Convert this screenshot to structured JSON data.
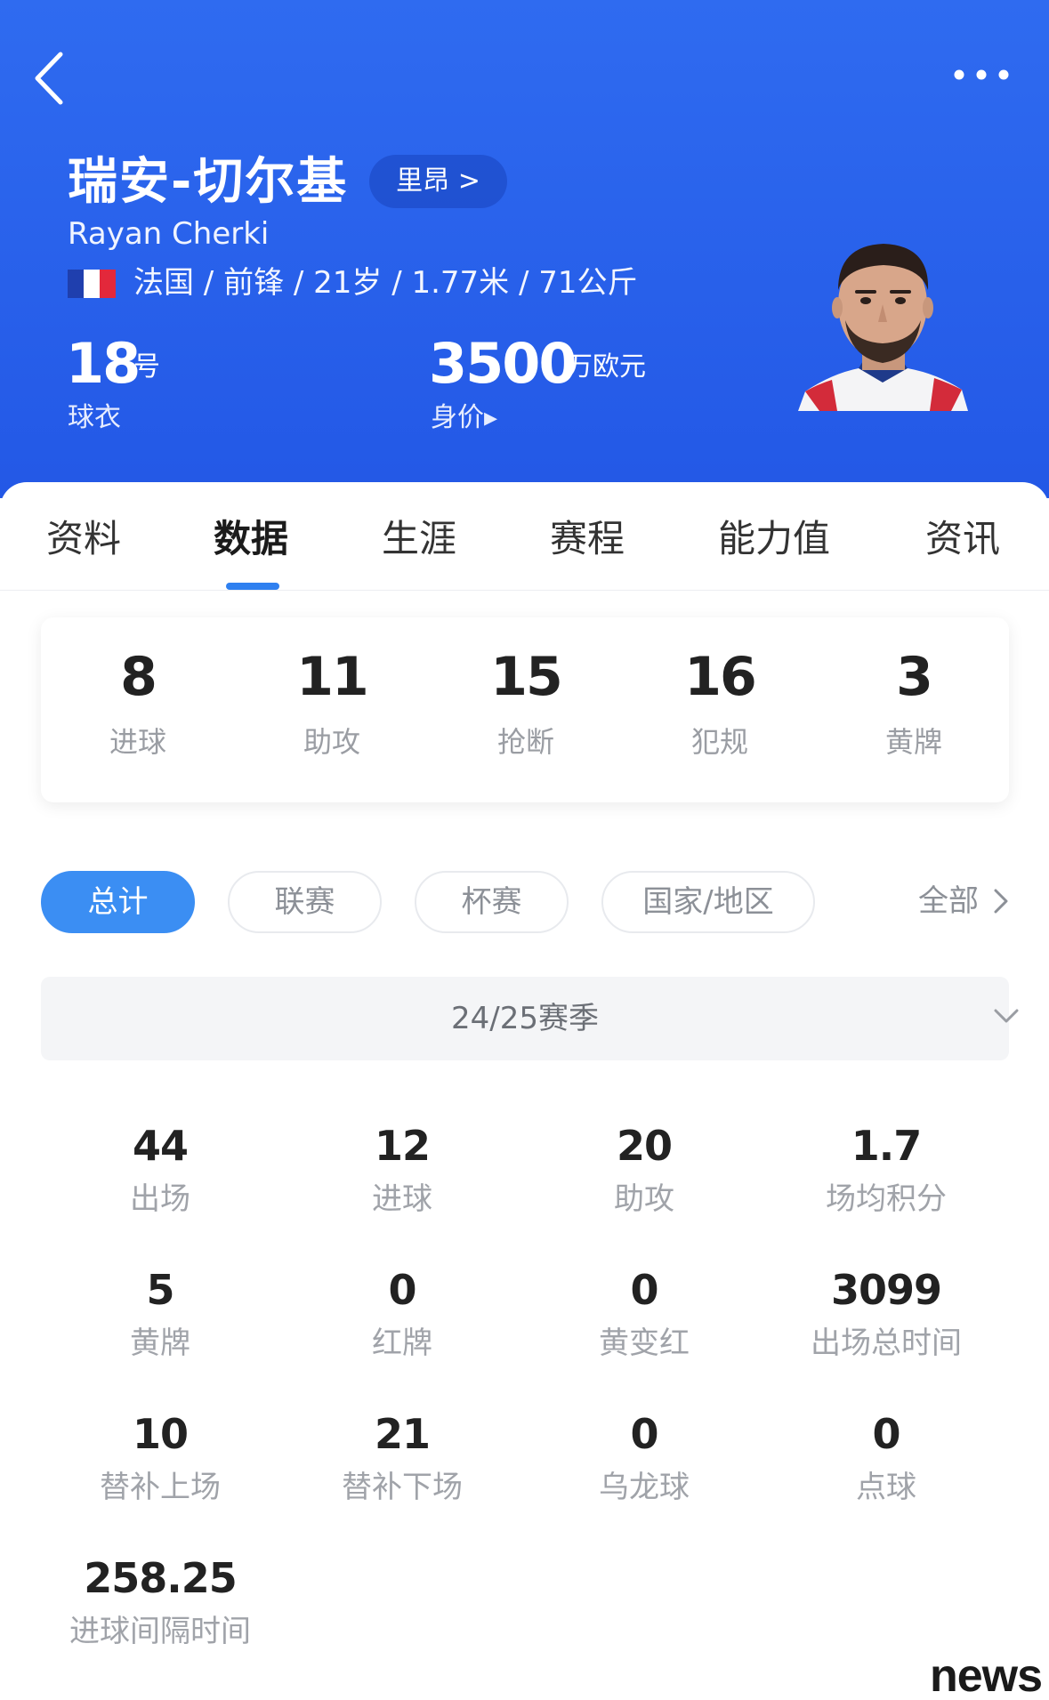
{
  "header": {
    "name_cn": "瑞安-切尔基",
    "team_link": "里昂 >",
    "name_en": "Rayan Cherki",
    "bio": "法国 / 前锋 / 21岁 / 1.77米 / 71公斤",
    "jersey_number": "18",
    "jersey_unit": "号",
    "jersey_label": "球衣",
    "market_value": "3500",
    "market_value_unit": "万欧元",
    "market_value_label": "身价▸",
    "flag_colors": [
      "#1f3fae",
      "#ffffff",
      "#e3283b"
    ],
    "background_color": "#2a62ea"
  },
  "tabs": [
    {
      "label": "资料",
      "active": false
    },
    {
      "label": "数据",
      "active": true
    },
    {
      "label": "生涯",
      "active": false
    },
    {
      "label": "赛程",
      "active": false
    },
    {
      "label": "能力值",
      "active": false
    },
    {
      "label": "资讯",
      "active": false
    }
  ],
  "summary": [
    {
      "value": "8",
      "label": "进球"
    },
    {
      "value": "11",
      "label": "助攻"
    },
    {
      "value": "15",
      "label": "抢断"
    },
    {
      "value": "16",
      "label": "犯规"
    },
    {
      "value": "3",
      "label": "黄牌"
    }
  ],
  "filters": {
    "chips": [
      "总计",
      "联赛",
      "杯赛",
      "国家/地区"
    ],
    "active_index": 0,
    "all_link": "全部",
    "accent_color": "#3b8ef3"
  },
  "season": {
    "selected": "24/25赛季"
  },
  "stats": [
    {
      "value": "44",
      "label": "出场"
    },
    {
      "value": "12",
      "label": "进球"
    },
    {
      "value": "20",
      "label": "助攻"
    },
    {
      "value": "1.7",
      "label": "场均积分"
    },
    {
      "value": "5",
      "label": "黄牌"
    },
    {
      "value": "0",
      "label": "红牌"
    },
    {
      "value": "0",
      "label": "黄变红"
    },
    {
      "value": "3099",
      "label": "出场总时间"
    },
    {
      "value": "10",
      "label": "替补上场"
    },
    {
      "value": "21",
      "label": "替补下场"
    },
    {
      "value": "0",
      "label": "乌龙球"
    },
    {
      "value": "0",
      "label": "点球"
    },
    {
      "value": "258.25",
      "label": "进球间隔时间"
    }
  ],
  "watermark": "news"
}
